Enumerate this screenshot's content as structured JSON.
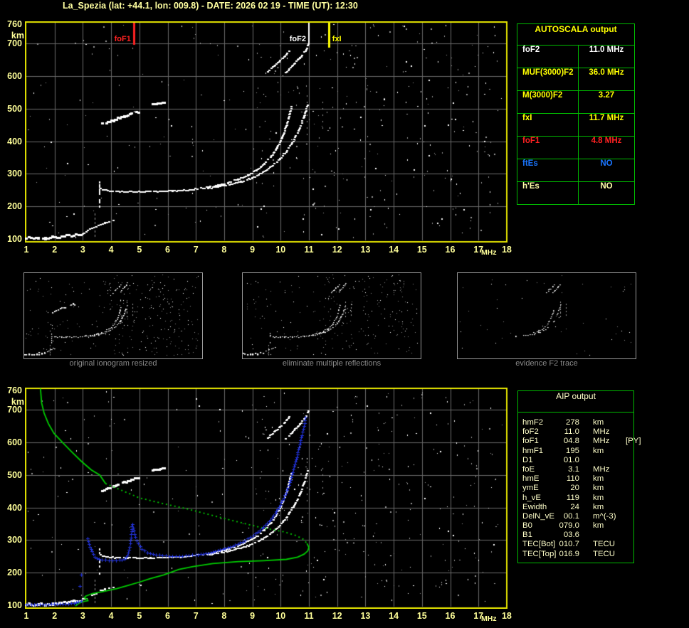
{
  "title": "La_Spezia (lat: +44.1, lon: 009.8) - DATE:  2026 02 19 - TIME (UT): 12:30",
  "colors": {
    "background": "#000000",
    "title_text": "#ffffa0",
    "axis_text": "#ffff99",
    "plot_border": "#e6e600",
    "grid": "#6a6a6a",
    "echo_white": "#ffffff",
    "echo_gray": "#9a9a9a",
    "profile_green": "#00cc00",
    "restored_blue": "#2233dd",
    "table_border": "#00bb00",
    "thumb_border": "#9a9a9a",
    "caption_text": "#8a8a8a",
    "autoscala_title": "#ffff00"
  },
  "autoscala_table": {
    "title": "AUTOSCALA output",
    "rows": [
      {
        "label": "foF2",
        "value": "11.0 MHz",
        "color": "#ffffff"
      },
      {
        "label": "MUF(3000)F2",
        "value": "36.0 MHz",
        "color": "#ffff00"
      },
      {
        "label": "M(3000)F2",
        "value": "3.27",
        "color": "#ffff00"
      },
      {
        "label": "fxI",
        "value": "11.7 MHz",
        "color": "#ffff00"
      },
      {
        "label": "foF1",
        "value": "4.8 MHz",
        "color": "#ff2222"
      },
      {
        "label": "ftEs",
        "value": "NO",
        "color": "#1a75ff"
      },
      {
        "label": "h'Es",
        "value": "NO",
        "color": "#ffffaa"
      }
    ]
  },
  "aip_table": {
    "title": "AIP output",
    "text_color": "#fdfdc8",
    "rows": [
      {
        "label": "hmF2",
        "value": "278",
        "unit": "km",
        "extra": ""
      },
      {
        "label": "foF2",
        "value": "11.0",
        "unit": "MHz",
        "extra": ""
      },
      {
        "label": "foF1",
        "value": "04.8",
        "unit": "MHz",
        "extra": "[PY]"
      },
      {
        "label": "hmF1",
        "value": "195",
        "unit": "km",
        "extra": ""
      },
      {
        "label": "D1",
        "value": "01.0",
        "unit": "",
        "extra": ""
      },
      {
        "label": "foE",
        "value": "3.1",
        "unit": "MHz",
        "extra": ""
      },
      {
        "label": "hmE",
        "value": "110",
        "unit": "km",
        "extra": ""
      },
      {
        "label": "ymE",
        "value": "20",
        "unit": "km",
        "extra": ""
      },
      {
        "label": "h_vE",
        "value": "119",
        "unit": "km",
        "extra": ""
      },
      {
        "label": "Ewidth",
        "value": "24",
        "unit": "km",
        "extra": ""
      },
      {
        "label": "DelN_vE",
        "value": "00.1",
        "unit": "m^(-3)",
        "extra": ""
      },
      {
        "label": "B0",
        "value": "079.0",
        "unit": "km",
        "extra": ""
      },
      {
        "label": "B1",
        "value": "03.6",
        "unit": "",
        "extra": ""
      },
      {
        "label": "TEC[Bot]",
        "value": "010.7",
        "unit": "TECU",
        "extra": ""
      },
      {
        "label": "TEC[Top]",
        "value": "016.9",
        "unit": "TECU",
        "extra": ""
      }
    ]
  },
  "thumbnails": [
    {
      "caption": "original ionogram resized"
    },
    {
      "caption": "eliminate multiple reflections"
    },
    {
      "caption": "evidence F2 trace"
    }
  ],
  "chart_data": {
    "type": "scatter",
    "description": "Ionogram (virtual height vs sounding frequency) with AUTOSCALA scaled parameters, plus inverted electron-density profile (green) and restored trace (blue)",
    "x_axis": {
      "unit": "MHz",
      "min": 1,
      "max": 18,
      "ticks": [
        1,
        2,
        3,
        4,
        5,
        6,
        7,
        8,
        9,
        10,
        11,
        12,
        13,
        14,
        15,
        16,
        17,
        18
      ]
    },
    "y_axis": {
      "unit": "km",
      "min": 100,
      "max": 760,
      "ticks": [
        760,
        700,
        600,
        500,
        400,
        300,
        200,
        100
      ]
    },
    "markers": [
      {
        "name": "foF1",
        "f": 4.8,
        "color": "#ff2222",
        "line_width": 3,
        "label_side": "left"
      },
      {
        "name": "foF2",
        "f": 11.0,
        "color": "#ffffff",
        "line_width": 2,
        "label_side": "left"
      },
      {
        "name": "fxI",
        "f": 11.7,
        "color": "#ffff00",
        "line_width": 3,
        "label_side": "right"
      }
    ],
    "echo_traces": {
      "e_layer": [
        [
          1.02,
          102
        ],
        [
          1.2,
          101
        ],
        [
          1.45,
          102
        ],
        [
          1.7,
          101
        ],
        [
          1.95,
          103
        ],
        [
          2.2,
          105
        ],
        [
          2.45,
          107
        ],
        [
          2.7,
          110
        ],
        [
          2.95,
          113
        ]
      ],
      "e_tail": [
        [
          2.95,
          113
        ],
        [
          3.2,
          124
        ],
        [
          3.5,
          137
        ],
        [
          3.8,
          148
        ],
        [
          4.1,
          155
        ]
      ],
      "foE_asymptote_dashes": {
        "f": 3.44,
        "h_from": 100,
        "h_to": 178
      },
      "f_cusp": [
        [
          3.6,
          198
        ],
        [
          3.6,
          272
        ]
      ],
      "o_branch": [
        [
          3.65,
          252
        ],
        [
          3.9,
          247
        ],
        [
          4.2,
          245
        ],
        [
          4.6,
          244
        ],
        [
          5.0,
          244
        ],
        [
          5.4,
          244
        ],
        [
          5.8,
          245
        ],
        [
          6.2,
          246
        ],
        [
          6.6,
          248
        ],
        [
          7.0,
          252
        ],
        [
          7.4,
          257
        ],
        [
          7.8,
          263
        ],
        [
          8.15,
          271
        ],
        [
          8.5,
          281
        ],
        [
          8.85,
          294
        ],
        [
          9.15,
          310
        ],
        [
          9.45,
          330
        ],
        [
          9.7,
          354
        ],
        [
          9.9,
          381
        ],
        [
          10.07,
          410
        ],
        [
          10.2,
          440
        ],
        [
          10.3,
          470
        ],
        [
          10.4,
          505
        ]
      ],
      "o_tip": [
        [
          9.56,
          612
        ],
        [
          9.78,
          630
        ],
        [
          10.0,
          647
        ],
        [
          10.18,
          661
        ],
        [
          10.33,
          678
        ]
      ],
      "x_branch": [
        [
          7.45,
          255
        ],
        [
          7.8,
          259
        ],
        [
          8.2,
          265
        ],
        [
          8.6,
          274
        ],
        [
          9.0,
          286
        ],
        [
          9.35,
          301
        ],
        [
          9.7,
          321
        ],
        [
          10.0,
          345
        ],
        [
          10.25,
          372
        ],
        [
          10.5,
          405
        ],
        [
          10.7,
          440
        ],
        [
          10.85,
          475
        ],
        [
          10.97,
          510
        ]
      ],
      "x_tip": [
        [
          10.2,
          610
        ],
        [
          10.45,
          632
        ],
        [
          10.7,
          655
        ],
        [
          10.9,
          676
        ],
        [
          10.99,
          696
        ]
      ],
      "asymptote_dots": [
        {
          "f": 10.93,
          "h_from": 420,
          "h_to": 540
        },
        {
          "f": 11.5,
          "h_from": 430,
          "h_to": 520
        }
      ],
      "multiple_reflections": [
        [
          [
            3.72,
            452
          ],
          [
            4.1,
            463
          ],
          [
            4.5,
            476
          ],
          [
            4.98,
            490
          ]
        ],
        [
          [
            5.5,
            512
          ],
          [
            5.72,
            516
          ],
          [
            5.9,
            519
          ]
        ]
      ]
    },
    "profile_green": {
      "topside_solid": [
        [
          1.5,
          766
        ],
        [
          1.54,
          722
        ],
        [
          1.63,
          690
        ],
        [
          1.78,
          658
        ],
        [
          1.98,
          628
        ],
        [
          2.28,
          600
        ],
        [
          2.6,
          572
        ],
        [
          2.95,
          542
        ],
        [
          3.3,
          516
        ],
        [
          3.6,
          500
        ],
        [
          3.8,
          474
        ]
      ],
      "middle_dotted": [
        [
          3.8,
          474
        ],
        [
          4.4,
          452
        ],
        [
          5.0,
          430
        ],
        [
          5.85,
          412
        ],
        [
          6.7,
          396
        ],
        [
          7.55,
          377
        ],
        [
          8.4,
          358
        ],
        [
          9.25,
          340
        ],
        [
          10.1,
          326
        ],
        [
          10.55,
          314
        ],
        [
          10.8,
          303
        ],
        [
          10.93,
          290
        ]
      ],
      "bottomside_solid": [
        [
          10.93,
          290
        ],
        [
          11.0,
          278
        ],
        [
          10.96,
          267
        ],
        [
          10.83,
          257
        ],
        [
          10.6,
          248
        ],
        [
          10.2,
          241
        ],
        [
          9.4,
          237
        ],
        [
          8.5,
          234
        ],
        [
          7.6,
          228
        ],
        [
          6.9,
          219
        ],
        [
          6.4,
          210
        ],
        [
          5.86,
          193
        ],
        [
          5.4,
          182
        ],
        [
          5.0,
          171
        ],
        [
          4.6,
          161
        ],
        [
          4.2,
          151
        ],
        [
          3.7,
          142
        ],
        [
          3.34,
          136
        ],
        [
          3.1,
          128
        ],
        [
          3.05,
          123
        ],
        [
          3.16,
          118
        ],
        [
          3.18,
          114
        ],
        [
          3.0,
          111
        ],
        [
          2.88,
          107
        ],
        [
          2.8,
          102
        ],
        [
          2.74,
          98
        ]
      ]
    },
    "restored_trace_blue": {
      "segments": [
        {
          "interp": true,
          "pts": [
            [
              1.0,
              101
            ],
            [
              1.4,
              101
            ],
            [
              1.8,
              102
            ],
            [
              2.2,
              103
            ],
            [
              2.5,
              104
            ],
            [
              2.7,
              106
            ],
            [
              2.85,
              109
            ],
            [
              2.95,
              112
            ]
          ]
        },
        {
          "interp": false,
          "pts": [
            [
              2.91,
              157
            ],
            [
              2.96,
              193
            ]
          ]
        },
        {
          "interp": true,
          "pts": [
            [
              3.17,
              304
            ],
            [
              3.24,
              286
            ],
            [
              3.32,
              265
            ],
            [
              3.44,
              248
            ],
            [
              3.58,
              240
            ],
            [
              3.8,
              238
            ],
            [
              4.05,
              237
            ],
            [
              4.3,
              238
            ],
            [
              4.48,
              241
            ],
            [
              4.6,
              252
            ],
            [
              4.68,
              288
            ],
            [
              4.73,
              326
            ],
            [
              4.76,
              348
            ],
            [
              4.81,
              328
            ],
            [
              4.87,
              308
            ],
            [
              4.97,
              288
            ],
            [
              5.1,
              272
            ],
            [
              5.3,
              261
            ],
            [
              5.6,
              254
            ],
            [
              5.95,
              251
            ],
            [
              6.3,
              250
            ],
            [
              6.65,
              251
            ],
            [
              7.0,
              254
            ],
            [
              7.35,
              258
            ],
            [
              7.7,
              264
            ],
            [
              8.05,
              273
            ],
            [
              8.4,
              284
            ],
            [
              8.75,
              298
            ],
            [
              9.05,
              314
            ],
            [
              9.35,
              334
            ],
            [
              9.6,
              356
            ],
            [
              9.82,
              381
            ],
            [
              10.0,
              408
            ],
            [
              10.16,
              437
            ],
            [
              10.3,
              468
            ],
            [
              10.42,
              500
            ],
            [
              10.52,
              532
            ],
            [
              10.6,
              562
            ],
            [
              10.68,
              592
            ],
            [
              10.76,
              622
            ],
            [
              10.83,
              650
            ],
            [
              10.89,
              676
            ]
          ]
        }
      ]
    },
    "noise": {
      "approx_dots_main_plot": 400,
      "approx_dots_thumbs": [
        300,
        250,
        48
      ]
    }
  }
}
